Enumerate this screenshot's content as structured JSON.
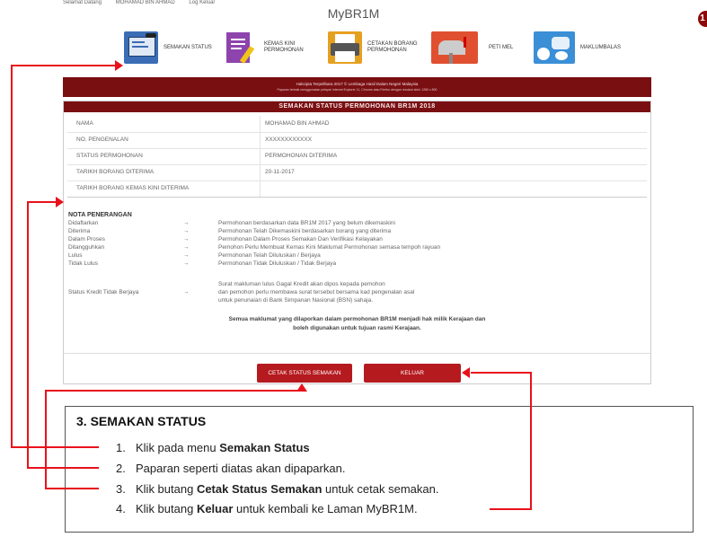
{
  "top_strip": [
    "Selamat Datang",
    "MOHAMAD BIN AHMAD",
    "Log Keluar"
  ],
  "app_title": "MyBR1M",
  "corner_badge": "1",
  "menu": [
    {
      "label": "SEMAKAN STATUS",
      "icon": "status-check-icon",
      "color": "#3a6db5"
    },
    {
      "label": "KEMAS KINI PERMOHONAN",
      "icon": "edit-document-icon",
      "color": "#8e44ad"
    },
    {
      "label": "CETAKAN BORANG PERMOHONAN",
      "icon": "printer-icon",
      "color": "#e6a020"
    },
    {
      "label": "PETI MEL",
      "icon": "mailbox-icon",
      "color": "#e05030"
    },
    {
      "label": "MAKLUMBALAS",
      "icon": "feedback-icon",
      "color": "#3b8fd6"
    }
  ],
  "banner": {
    "line1": "Hakcipta Terpelihara 2017 © Lembaga Hasil Dalam Negeri Malaysia",
    "line2": "Paparan terbaik menggunakan pelayar Internet Explorer 11, Chrome atau Firefox dengan resolusi skrin 1280 x 800"
  },
  "status_table": {
    "heading": "SEMAKAN STATUS PERMOHONAN BR1M 2018",
    "rows": [
      {
        "label": "NAMA",
        "value": "MOHAMAD BIN AHMAD"
      },
      {
        "label": "NO. PENGENALAN",
        "value": "XXXXXXXXXXXX"
      },
      {
        "label": "STATUS PERMOHONAN",
        "value": "PERMOHONAN DITERIMA"
      },
      {
        "label": "TARIKH BORANG DITERIMA",
        "value": "20-11-2017"
      },
      {
        "label": "TARIKH BORANG KEMAS KINI DITERIMA",
        "value": ""
      }
    ]
  },
  "nota": {
    "title": "NOTA PENERANGAN",
    "arrow": "→",
    "items": [
      {
        "term": "Didaftarkan",
        "desc": "Permohonan berdasarkan data BR1M 2017 yang belum dikemaskini"
      },
      {
        "term": "Diterima",
        "desc": "Permohonan Telah Dikemaskini berdasarkan borang yang diterima"
      },
      {
        "term": "Dalam Proses",
        "desc": "Permohonan Dalam Proses Semakan Dan Verifikasi Kelayakan"
      },
      {
        "term": "Ditangguhkan",
        "desc": "Pemohon Perlu Membuat Kemas Kini Maklumat Permohonan semasa tempoh rayuan"
      },
      {
        "term": "Lulus",
        "desc": "Permohonan Telah Diluluskan / Berjaya"
      },
      {
        "term": "Tidak Lulus",
        "desc": "Permohonan Tidak Diluluskan / Tidak Berjaya"
      }
    ],
    "kredit_term": "Status Kredit Tidak Berjaya",
    "kredit_desc": [
      "Surat makluman lulus Gagal Kredit akan dipos kepada pemohon",
      "dan pemohon perlu membawa surat tersebut bersama kad pengenalan asal",
      "untuk penunaian di Bank Simpanan Nasional (BSN) sahaja."
    ],
    "bold_note": [
      "Semua maklumat yang dilaporkan dalam permohonan BR1M menjadi hak milik Kerajaan dan",
      "boleh digunakan untuk tujuan rasmi Kerajaan."
    ]
  },
  "buttons": {
    "print": "CETAK STATUS SEMAKAN",
    "exit": "KELUAR"
  },
  "instructions": {
    "title": "3. SEMAKAN STATUS",
    "steps": [
      {
        "num": "1.",
        "pre": "Klik pada menu ",
        "bold": "Semakan Status",
        "post": ""
      },
      {
        "num": "2.",
        "pre": "Paparan seperti diatas akan dipaparkan.",
        "bold": "",
        "post": ""
      },
      {
        "num": "3.",
        "pre": "Klik butang ",
        "bold": "Cetak Status Semakan",
        "post": " untuk cetak semakan."
      },
      {
        "num": "4.",
        "pre": "Klik butang ",
        "bold": "Keluar",
        "post": "  untuk kembali ke Laman MyBR1M."
      }
    ]
  },
  "colors": {
    "brand_dark_red": "#7a0f12",
    "button_red": "#b51a1f",
    "callout_red": "#e8111b"
  }
}
